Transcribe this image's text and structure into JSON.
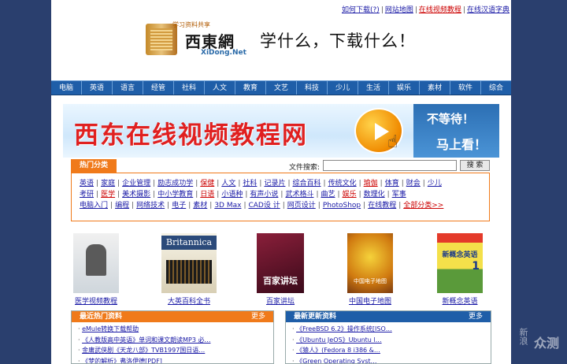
{
  "toplinks": {
    "items": [
      {
        "label": "如何下载(?)",
        "red": false
      },
      {
        "label": "网站地图",
        "red": false
      },
      {
        "label": "在线视频教程",
        "red": true
      },
      {
        "label": "在线汉语字典",
        "red": false
      }
    ]
  },
  "logo": {
    "sub": "学习资料共享",
    "cn": "西東網",
    "en": "XiDong.Net"
  },
  "slogan": "学什么，下载什么！",
  "nav": [
    "电脑",
    "英语",
    "语言",
    "经管",
    "社科",
    "人文",
    "教育",
    "文艺",
    "科技",
    "少儿",
    "生活",
    "娱乐",
    "素材",
    "软件",
    "综合"
  ],
  "banner": {
    "title": "西东在线视频教程网",
    "right1": "不等待！",
    "right2": "马上看！"
  },
  "categories": {
    "tab_label": "热门分类",
    "search_label": "文件搜索:",
    "search_value": "",
    "search_button": "搜 索",
    "line1": [
      {
        "t": "英语"
      },
      {
        "t": "家庭"
      },
      {
        "t": "企业管理"
      },
      {
        "t": "励志成功学"
      },
      {
        "t": "保健",
        "r": true
      },
      {
        "t": "人文"
      },
      {
        "t": "社科"
      },
      {
        "t": "记录片"
      },
      {
        "t": "综合百科"
      },
      {
        "t": "传统文化"
      },
      {
        "t": "瑜伽",
        "r": true
      },
      {
        "t": "体育"
      },
      {
        "t": "财会"
      },
      {
        "t": "少儿"
      }
    ],
    "line2": [
      {
        "t": "考研"
      },
      {
        "t": "医学",
        "r": true
      },
      {
        "t": "美术摄影"
      },
      {
        "t": "中小学教育"
      },
      {
        "t": "日语",
        "r": true
      },
      {
        "t": "小语种"
      },
      {
        "t": "有声小说"
      },
      {
        "t": "武术格斗"
      },
      {
        "t": "曲艺"
      },
      {
        "t": "娱乐",
        "r": true
      },
      {
        "t": "数理化"
      },
      {
        "t": "军事"
      }
    ],
    "line3": [
      {
        "t": "电脑入门"
      },
      {
        "t": "编程"
      },
      {
        "t": "网络技术"
      },
      {
        "t": "电子"
      },
      {
        "t": "素材"
      },
      {
        "t": "3D Max"
      },
      {
        "t": "CAD设 计"
      },
      {
        "t": "网页设计"
      },
      {
        "t": "PhotoShop"
      },
      {
        "t": "在线教程"
      },
      {
        "t": "全部分类>>",
        "r": true
      }
    ]
  },
  "products": [
    {
      "caption": "医学视频教程"
    },
    {
      "caption": "大英百科全书",
      "cover_title": "Britannica"
    },
    {
      "caption": "百家讲坛",
      "cover_title": "百家讲坛"
    },
    {
      "caption": "中国电子地图",
      "cover_title": "中国电子地图"
    },
    {
      "caption": "新概念英语",
      "cover_title": "新概念英语",
      "cover_num": "1"
    }
  ],
  "panel_left": {
    "title": "最近热门资料",
    "more": "更多",
    "items": [
      "eMule转换下载帮助",
      "《人教版高中英语》单词和课文朗读MP3 必…",
      "金庸武侠剧《天龙八部》TVB1997国日语…",
      "《梦的解析》弗洛伊德[PDF]"
    ]
  },
  "panel_right": {
    "title": "最新更新资料",
    "more": "更多",
    "items": [
      "《FreeBSD 6.2》操作系统[ISO…",
      "《Ubuntu JeOS》Ubuntu l…",
      "《猿人》(Fedora 8 i386 &…",
      "《Green Operating Syst…"
    ]
  },
  "watermark": {
    "side": "新浪",
    "text": "众测"
  }
}
